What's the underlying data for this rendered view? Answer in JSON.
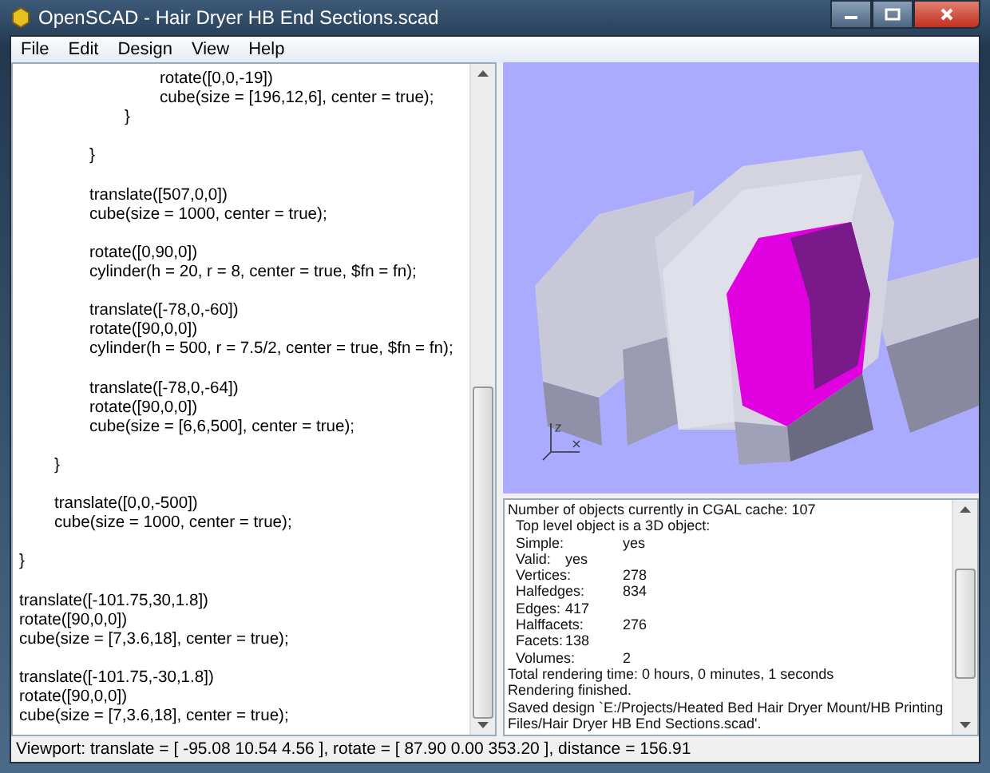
{
  "window": {
    "title": "OpenSCAD - Hair Dryer HB End Sections.scad"
  },
  "menu": [
    "File",
    "Edit",
    "Design",
    "View",
    "Help"
  ],
  "editor": {
    "blocks": [
      [
        "\t\t\t\trotate([0,0,-19])",
        "\t\t\t\tcube(size = [196,12,6], center = true);",
        "\t\t\t}"
      ],
      [
        "\t\t}"
      ],
      [
        "\t\ttranslate([507,0,0])",
        "\t\tcube(size = 1000, center = true);"
      ],
      [
        "\t\trotate([0,90,0])",
        "\t\tcylinder(h = 20, r = 8, center = true, $fn = fn);"
      ],
      [
        "\t\ttranslate([-78,0,-60])",
        "\t\trotate([90,0,0])",
        "\t\tcylinder(h = 500, r = 7.5/2, center = true, $fn = fn);"
      ],
      [
        "\t\ttranslate([-78,0,-64])",
        "\t\trotate([90,0,0])",
        "\t\tcube(size = [6,6,500], center = true);"
      ],
      [
        "\t}"
      ],
      [
        "\ttranslate([0,0,-500])",
        "\tcube(size = 1000, center = true);"
      ],
      [
        "}"
      ],
      [
        "translate([-101.75,30,1.8])",
        "rotate([90,0,0])",
        "cube(size = [7,3.6,18], center = true);"
      ],
      [
        "translate([-101.75,-30,1.8])",
        "rotate([90,0,0])",
        "cube(size = [7,3.6,18], center = true);"
      ]
    ]
  },
  "console": {
    "lines": [
      "Number of objects currently in CGAL cache: 107",
      "  Top level object is a 3D object:",
      "  Simple:\tyes",
      "  Valid:\tyes",
      "  Vertices:\t278",
      "  Halfedges:\t834",
      "  Edges:\t417",
      "  Halffacets:\t276",
      "  Facets:\t138",
      "  Volumes:\t2",
      "Total rendering time: 0 hours, 0 minutes, 1 seconds",
      "Rendering finished.",
      "Saved design `E:/Projects/Heated Bed Hair Dryer Mount/HB Printing Files/Hair Dryer HB End Sections.scad'."
    ]
  },
  "status_bar": "Viewport: translate = [ -95.08 10.54 4.56 ], rotate = [ 87.90 0.00 353.20 ], distance = 156.91"
}
